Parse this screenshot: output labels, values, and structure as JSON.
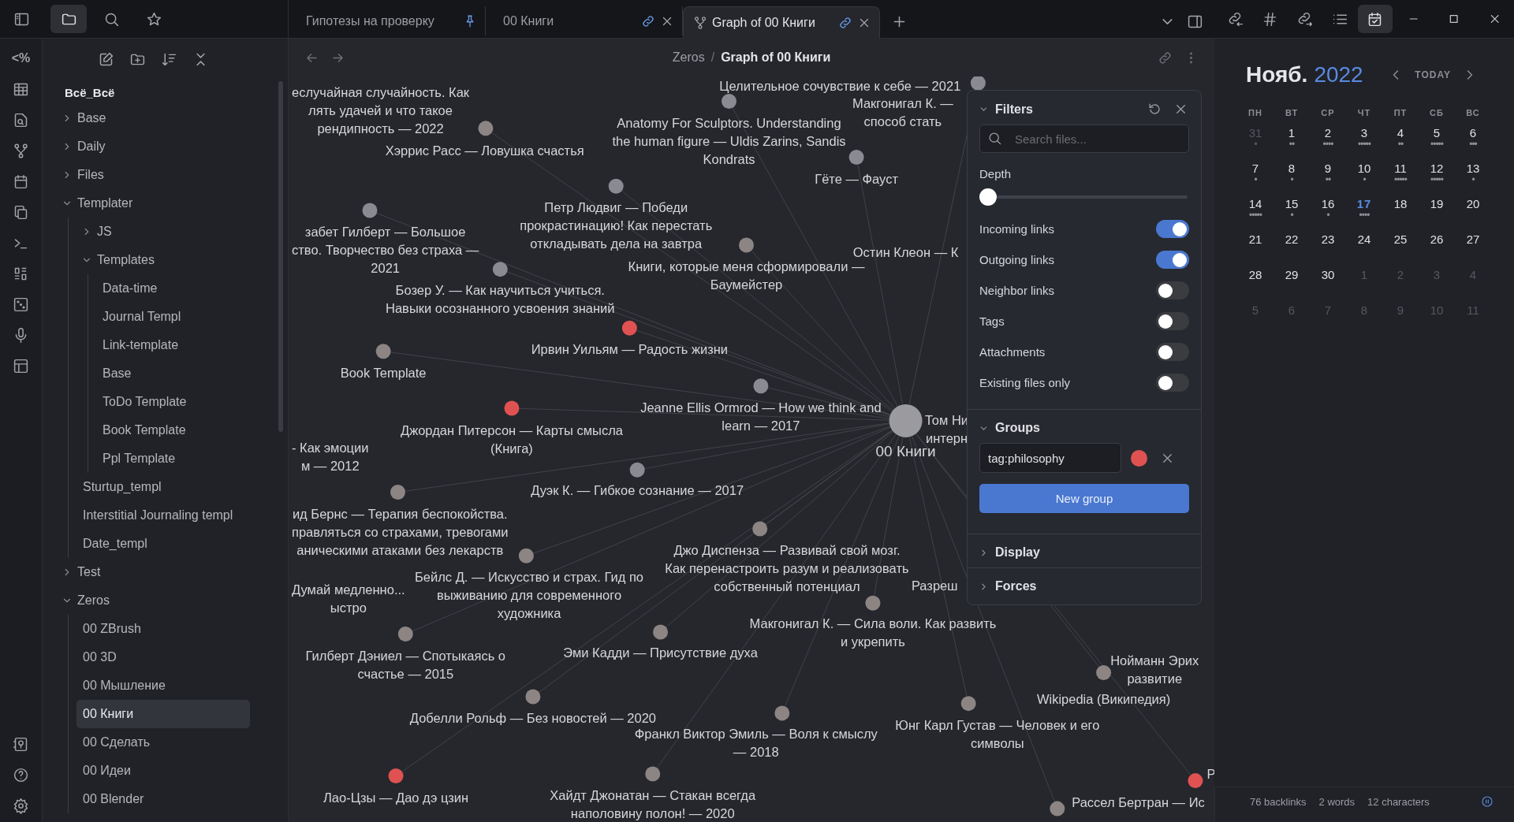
{
  "ribbon": {
    "glyph": "<%"
  },
  "left_tabs": [
    {
      "kind": "files",
      "selected": true
    },
    {
      "kind": "search",
      "selected": false
    },
    {
      "kind": "bookmarks",
      "selected": false
    }
  ],
  "tabs": [
    {
      "title": "Гипотезы на проверку",
      "kind": "pinned",
      "selected": false
    },
    {
      "title": "00 Книги",
      "kind": "linked",
      "selected": false
    },
    {
      "title": "Graph of 00 Книги",
      "kind": "graph",
      "selected": true
    }
  ],
  "right_tabs": [
    {
      "kind": "backlinks",
      "selected": false
    },
    {
      "kind": "tags",
      "selected": false
    },
    {
      "kind": "outgoing",
      "selected": false
    },
    {
      "kind": "outline",
      "selected": false
    },
    {
      "kind": "calendar",
      "selected": true
    }
  ],
  "file_explorer": {
    "vault": "Всё_Всё",
    "tree": [
      {
        "name": "Base",
        "kind": "folder",
        "expanded": false
      },
      {
        "name": "Daily",
        "kind": "folder",
        "expanded": false
      },
      {
        "name": "Files",
        "kind": "folder",
        "expanded": false
      },
      {
        "name": "Templater",
        "kind": "folder",
        "expanded": true,
        "children": [
          {
            "name": "JS",
            "kind": "folder",
            "expanded": false
          },
          {
            "name": "Templates",
            "kind": "folder",
            "expanded": true,
            "children": [
              {
                "name": "Data-time",
                "kind": "file",
                "selected": false
              },
              {
                "name": "Journal Templ",
                "kind": "file",
                "selected": false
              },
              {
                "name": "Link-template",
                "kind": "file",
                "selected": false
              },
              {
                "name": "Base",
                "kind": "file",
                "selected": false
              },
              {
                "name": "ToDo Template",
                "kind": "file",
                "selected": false
              },
              {
                "name": "Book Template",
                "kind": "file",
                "selected": false
              },
              {
                "name": "Ppl Template",
                "kind": "file",
                "selected": false
              }
            ]
          },
          {
            "name": "Sturtup_templ",
            "kind": "file",
            "selected": false
          },
          {
            "name": "Interstitial Journaling templ",
            "kind": "file",
            "selected": false
          },
          {
            "name": "Date_templ",
            "kind": "file",
            "selected": false
          }
        ]
      },
      {
        "name": "Test",
        "kind": "folder",
        "expanded": false
      },
      {
        "name": "Zeros",
        "kind": "folder",
        "expanded": true,
        "children": [
          {
            "name": "00 ZBrush",
            "kind": "file",
            "selected": false
          },
          {
            "name": "00 3D",
            "kind": "file",
            "selected": false
          },
          {
            "name": "00 Мышление",
            "kind": "file",
            "selected": false
          },
          {
            "name": "00 Книги",
            "kind": "file",
            "selected": true
          },
          {
            "name": "00 Сделать",
            "kind": "file",
            "selected": false
          },
          {
            "name": "00 Идеи",
            "kind": "file",
            "selected": false
          },
          {
            "name": "00 Blender",
            "kind": "file",
            "selected": false
          }
        ]
      }
    ]
  },
  "view_header": {
    "folder": "Zeros",
    "separator": "/",
    "title": "Graph of 00 Книги"
  },
  "graph": {
    "nodes": [
      {
        "kind": "note",
        "label": "еслучайная случайность. Как\nлять удачей и что такое\nрендипность — 2022"
      },
      {
        "kind": "note",
        "label": "Целительное сочувствие к себе — 2021"
      },
      {
        "kind": "note",
        "label": "Макгонигал К. —\nспособ стать",
        "color": "#8a8a93"
      },
      {
        "kind": "note",
        "label": "Хэррис Расс — Ловушка счастья",
        "color": "#8c8583"
      },
      {
        "kind": "note",
        "label": "Anatomy For Sculptors. Understanding\nthe human figure — Uldis Zarins, Sandis\nKondrats",
        "color": "#8a8a93"
      },
      {
        "kind": "note",
        "label": "Гёте — Фауст",
        "color": "#8a8a93"
      },
      {
        "kind": "note",
        "label": "Петр Людвиг — Победи\nпрокрастинацию! Как перестать\nоткладывать дела на завтра",
        "color": "#8a8a93"
      },
      {
        "kind": "note",
        "label": "забет Гилберт — Большое\nство. Творчество без страха —\n2021",
        "color": "#8a8a93"
      },
      {
        "kind": "note",
        "label": "Книги, которые меня сформировали —\nБаумейстер",
        "color": "#8c8583"
      },
      {
        "kind": "note",
        "label": "Остин Клеон — К"
      },
      {
        "kind": "note",
        "label": "Бозер У. — Как научиться учиться.\nНавыки осознанного усвоения знаний",
        "color": "#8a8a93"
      },
      {
        "kind": "note",
        "label": "Ирвин Уильям — Радость жизни",
        "color": "#e05252"
      },
      {
        "kind": "note",
        "label": "Book Template",
        "color": "#8c8583"
      },
      {
        "kind": "note",
        "label": "Jeanne Ellis Ormrod — How we think and\nlearn — 2017",
        "color": "#8a8a93"
      },
      {
        "kind": "note",
        "label": "Джордан Питерсон — Карты смысла\n(Книга)",
        "color": "#e05252"
      },
      {
        "kind": "hub",
        "label": "00 Книги",
        "color": "#9b9b9f"
      },
      {
        "kind": "note",
        "label": "Том Ни\nинтерн"
      },
      {
        "kind": "note",
        "label": "- Как эмоции\nм — 2012"
      },
      {
        "kind": "note",
        "label": "Дуэк К. — Гибкое сознание — 2017",
        "color": "#8a8a93"
      },
      {
        "kind": "note",
        "label": "ид Бернс — Терапия беспокойства.\nправляться со страхами, тревогами\nаническими атаками без лекарств",
        "color": "#8c8583"
      },
      {
        "kind": "note",
        "label": "Джо Диспенза — Развивай свой мозг.\nКак перенастроить разум и реализовать\nсобственный потенциал",
        "color": "#8c8583"
      },
      {
        "kind": "note",
        "label": "Думай медленно...\nыстро"
      },
      {
        "kind": "note",
        "label": "Бейлс Д. — Искусство и страх. Гид по\nвыживанию для современного\nхудожника",
        "color": "#8c8583"
      },
      {
        "kind": "note",
        "label": "Разреш"
      },
      {
        "kind": "note",
        "label": "Макгонигал К. — Сила воли. Как развить\nи укрепить",
        "color": "#8c8583"
      },
      {
        "kind": "note",
        "label": "Гилберт Дэниел — Спотыкаясь о\nсчастье — 2015",
        "color": "#8c8583"
      },
      {
        "kind": "note",
        "label": "Эми Кадди — Присутствие духа",
        "color": "#8c8583"
      },
      {
        "kind": "note",
        "label": "Нойманн Эрих\nразвитие"
      },
      {
        "kind": "note",
        "label": "Wikipedia (Википедия)",
        "color": "#8c8583"
      },
      {
        "kind": "note",
        "label": "Добелли Рольф — Без новостей — 2020",
        "color": "#8c8583"
      },
      {
        "kind": "note",
        "label": "Франкл Виктор Эмиль — Воля к смыслу\n— 2018",
        "color": "#8c8583"
      },
      {
        "kind": "note",
        "label": "Юнг Карл Густав — Человек и его\nсимволы",
        "color": "#8c8583"
      },
      {
        "kind": "note",
        "label": "Лао-Цзы — Дао дэ цзин",
        "color": "#e05252"
      },
      {
        "kind": "note",
        "label": "Хайдт Джонатан — Стакан всегда\nнаполовину полон! — 2020",
        "color": "#8c8583"
      },
      {
        "kind": "note",
        "label": "Р",
        "color": "#e05252"
      },
      {
        "kind": "note",
        "label": "Рассел Бертран — Ис",
        "color": "#8c8583"
      }
    ],
    "filters": {
      "title": "Filters",
      "expanded": true,
      "search_placeholder": "Search files...",
      "depth": {
        "label": "Depth",
        "level": 0
      },
      "toggles": [
        {
          "label": "Incoming links",
          "on": true
        },
        {
          "label": "Outgoing links",
          "on": true
        },
        {
          "label": "Neighbor links",
          "on": false
        },
        {
          "label": "Tags",
          "on": false
        },
        {
          "label": "Attachments",
          "on": false
        },
        {
          "label": "Existing files only",
          "on": false
        }
      ],
      "groups": {
        "title": "Groups",
        "expanded": true,
        "items": [
          {
            "query": "tag:philosophy",
            "color": "#e05252"
          }
        ],
        "new_button": "New group"
      },
      "sections": [
        {
          "title": "Display",
          "expanded": false
        },
        {
          "title": "Forces",
          "expanded": false
        }
      ]
    }
  },
  "calendar": {
    "month": "Нояб.",
    "year": "2022",
    "today_button": "TODAY",
    "weekdays": [
      "ПН",
      "ВТ",
      "СР",
      "ЧТ",
      "ПТ",
      "СБ",
      "ВС"
    ],
    "days": [
      {
        "day": "31",
        "dots": "•",
        "muted": true,
        "today": false
      },
      {
        "day": "1",
        "dots": "••",
        "muted": false,
        "today": false
      },
      {
        "day": "2",
        "dots": "••••",
        "muted": false,
        "today": false
      },
      {
        "day": "3",
        "dots": "•••••",
        "muted": false,
        "today": false
      },
      {
        "day": "4",
        "dots": "••",
        "muted": false,
        "today": false
      },
      {
        "day": "5",
        "dots": "•••••",
        "muted": false,
        "today": false
      },
      {
        "day": "6",
        "dots": "•••",
        "muted": false,
        "today": false
      },
      {
        "day": "7",
        "dots": "•",
        "muted": false,
        "today": false
      },
      {
        "day": "8",
        "dots": "•",
        "muted": false,
        "today": false
      },
      {
        "day": "9",
        "dots": "••",
        "muted": false,
        "today": false
      },
      {
        "day": "10",
        "dots": "•",
        "muted": false,
        "today": false
      },
      {
        "day": "11",
        "dots": "•••••",
        "muted": false,
        "today": false
      },
      {
        "day": "12",
        "dots": "•••••",
        "muted": false,
        "today": false
      },
      {
        "day": "13",
        "dots": "•",
        "muted": false,
        "today": false
      },
      {
        "day": "14",
        "dots": "•••••",
        "muted": false,
        "today": false
      },
      {
        "day": "15",
        "dots": "•",
        "muted": false,
        "today": false
      },
      {
        "day": "16",
        "dots": "•",
        "muted": false,
        "today": false
      },
      {
        "day": "17",
        "dots": "••••",
        "muted": false,
        "today": true
      },
      {
        "day": "18",
        "muted": false,
        "today": false
      },
      {
        "day": "19",
        "muted": false,
        "today": false
      },
      {
        "day": "20",
        "muted": false,
        "today": false
      },
      {
        "day": "21",
        "muted": false,
        "today": false
      },
      {
        "day": "22",
        "muted": false,
        "today": false
      },
      {
        "day": "23",
        "muted": false,
        "today": false
      },
      {
        "day": "24",
        "muted": false,
        "today": false
      },
      {
        "day": "25",
        "muted": false,
        "today": false
      },
      {
        "day": "26",
        "muted": false,
        "today": false
      },
      {
        "day": "27",
        "muted": false,
        "today": false
      },
      {
        "day": "28",
        "muted": false,
        "today": false
      },
      {
        "day": "29",
        "muted": false,
        "today": false
      },
      {
        "day": "30",
        "muted": false,
        "today": false
      },
      {
        "day": "1",
        "muted": true,
        "today": false
      },
      {
        "day": "2",
        "muted": true,
        "today": false
      },
      {
        "day": "3",
        "muted": true,
        "today": false
      },
      {
        "day": "4",
        "muted": true,
        "today": false
      },
      {
        "day": "5",
        "muted": true,
        "today": false
      },
      {
        "day": "6",
        "muted": true,
        "today": false
      },
      {
        "day": "7",
        "muted": true,
        "today": false
      },
      {
        "day": "8",
        "muted": true,
        "today": false
      },
      {
        "day": "9",
        "muted": true,
        "today": false
      },
      {
        "day": "10",
        "muted": true,
        "today": false
      },
      {
        "day": "11",
        "muted": true,
        "today": false
      }
    ]
  },
  "status_bar": [
    "76 backlinks",
    "2 words",
    "12 characters"
  ]
}
